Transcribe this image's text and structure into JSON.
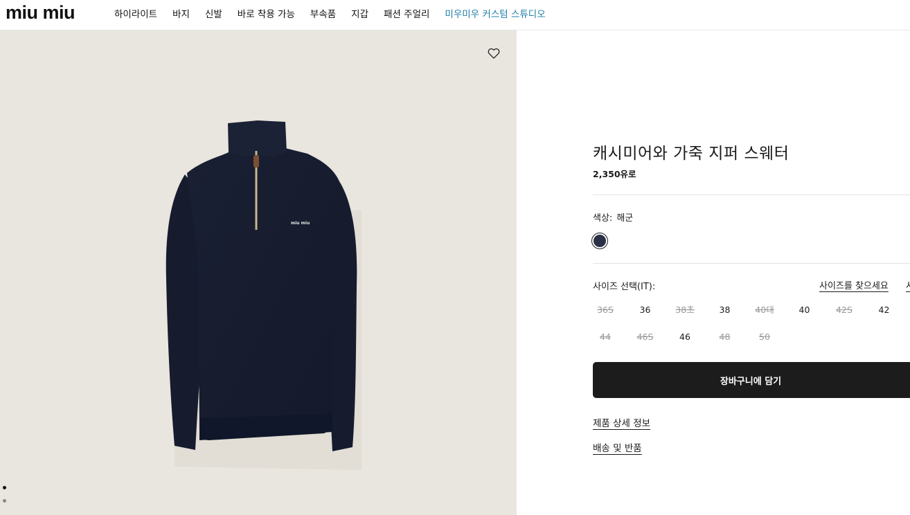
{
  "header": {
    "logo_text": "miu miu",
    "nav": [
      {
        "label": "하이라이트",
        "accent": false
      },
      {
        "label": "바지",
        "accent": false
      },
      {
        "label": "신발",
        "accent": false
      },
      {
        "label": "바로 착용 가능",
        "accent": false
      },
      {
        "label": "부속품",
        "accent": false
      },
      {
        "label": "지갑",
        "accent": false
      },
      {
        "label": "패션 주얼리",
        "accent": false
      },
      {
        "label": "미우미우 커스텀 스튜디오",
        "accent": true
      }
    ]
  },
  "gallery": {
    "wishlist_icon": "heart-outline-icon",
    "background_color": "#e9e5df",
    "dots": 2,
    "active_dot": 0
  },
  "product": {
    "title": "캐시미어와 가죽 지퍼 스웨터",
    "price": "2,350유로",
    "color_label": "색상:",
    "color_value": "해군",
    "swatch_color": "#2a3146",
    "size_label": "사이즈 선택(IT):",
    "size_guide_label": "사이즈를 찾으세요",
    "size_more_label": "사",
    "sizes": [
      {
        "label": "36S",
        "available": false
      },
      {
        "label": "36",
        "available": true
      },
      {
        "label": "38초",
        "available": false
      },
      {
        "label": "38",
        "available": true
      },
      {
        "label": "40대",
        "available": false
      },
      {
        "label": "40",
        "available": true
      },
      {
        "label": "42S",
        "available": false
      },
      {
        "label": "42",
        "available": true
      },
      {
        "label": "44",
        "available": false
      },
      {
        "label": "46S",
        "available": false
      },
      {
        "label": "46",
        "available": true
      },
      {
        "label": "48",
        "available": false
      },
      {
        "label": "50",
        "available": false
      }
    ],
    "add_to_cart_label": "장바구니에 담기",
    "details_link": "제품 상세 정보",
    "shipping_link": "배송 및 반품"
  }
}
